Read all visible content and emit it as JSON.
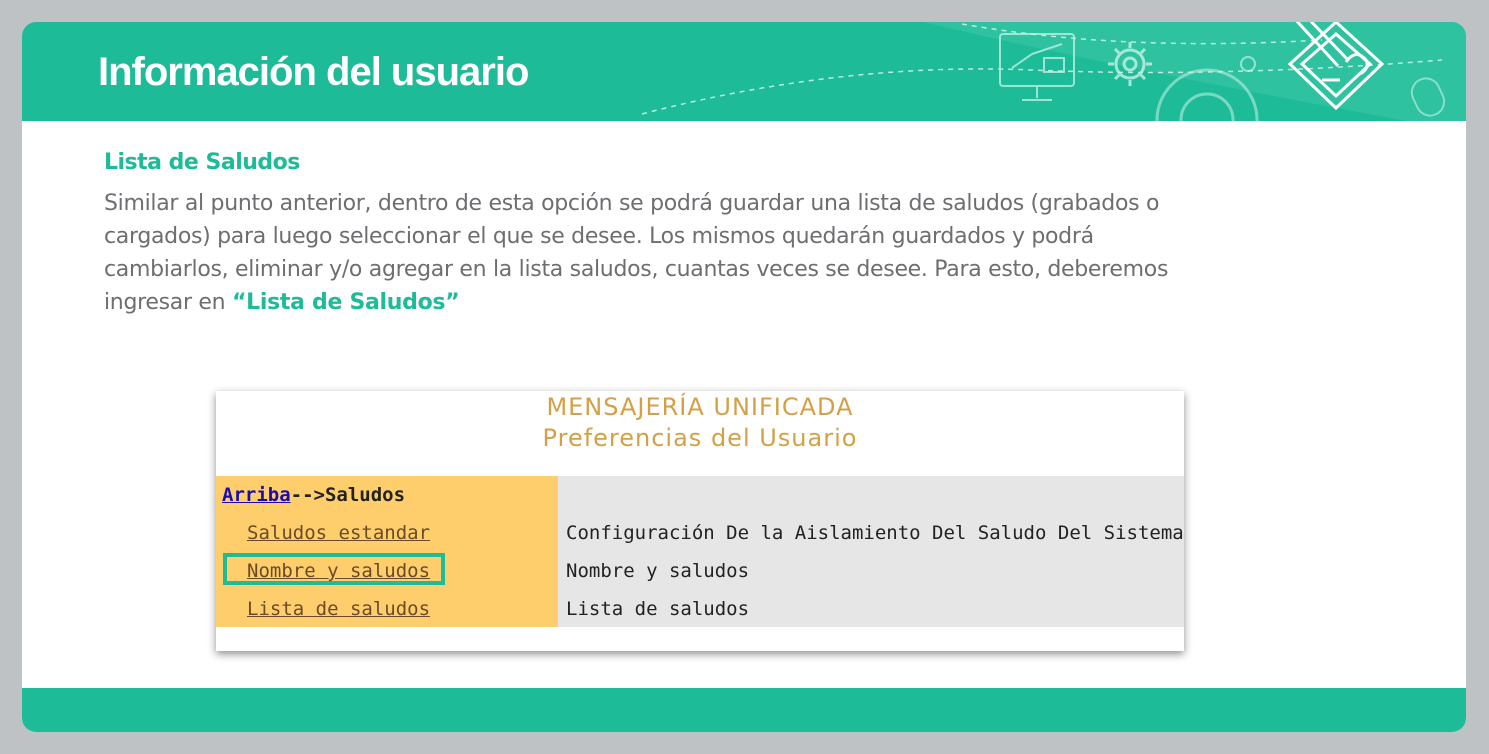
{
  "banner": {
    "title": "Información del usuario"
  },
  "icons": [
    "monitor-presentation-icon",
    "gear-icon",
    "large-gear-icon",
    "mouse-icon",
    "pencil-diamond-logo-icon"
  ],
  "section": {
    "heading": "Lista de Saludos",
    "paragraph_lines": [
      "Similar al punto anterior, dentro de esta opción se podrá guardar una lista de saludos (grabados o",
      "cargados) para luego seleccionar el que se desee. Los mismos quedarán guardados y podrá",
      "cambiarlos, eliminar y/o agregar en la lista saludos, cuantas veces se desee. Para esto, deberemos"
    ],
    "last_line_prefix": "ingresar en ",
    "last_line_highlight": "“Lista de Saludos”"
  },
  "screenshot": {
    "title_line1": "MENSAJERÍA UNIFICADA",
    "title_line2": "Preferencias del Usuario",
    "breadcrumb_link": "Arriba",
    "breadcrumb_rest": "-->Saludos",
    "options": [
      {
        "label": "Saludos estandar",
        "description": "Configuración De la Aislamiento Del Saludo Del Sistema"
      },
      {
        "label": "Nombre y saludos",
        "description": "Nombre y saludos"
      },
      {
        "label": "Lista de saludos",
        "description": "Lista de saludos"
      }
    ],
    "highlighted_option": "Nombre y saludos"
  },
  "colors": {
    "brand_green": "#1dbb98",
    "menu_yellow": "#fece6c",
    "title_gold": "#d4a046",
    "body_text": "#6d6e71",
    "background": "#bfc2c5"
  }
}
